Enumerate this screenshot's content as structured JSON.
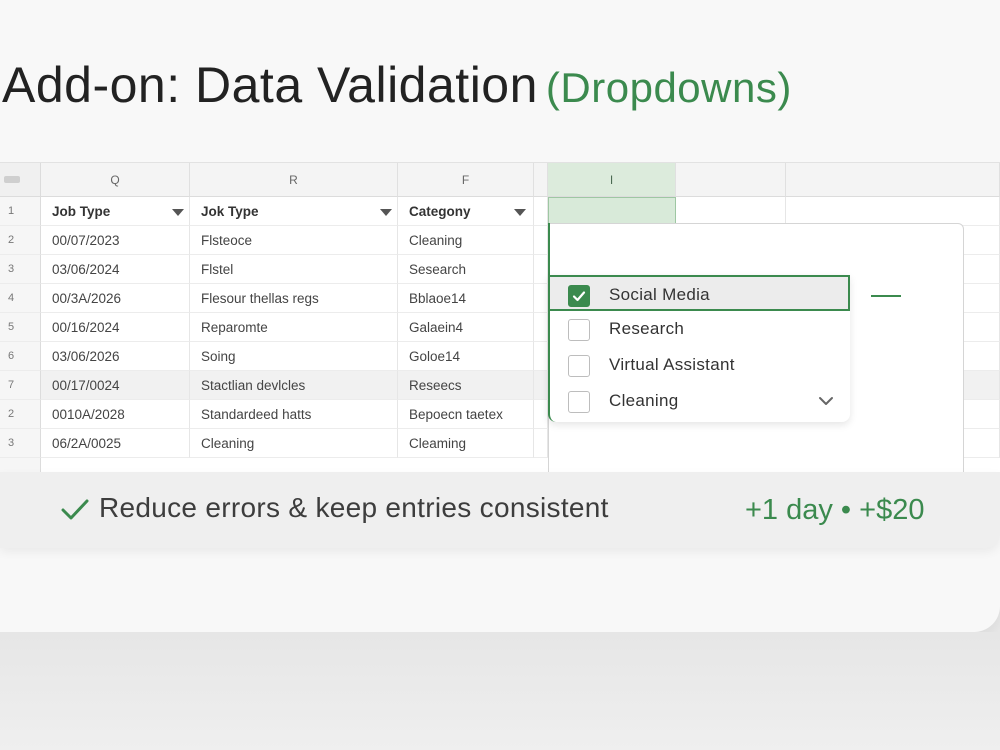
{
  "title": {
    "main": "Add-on: Data Validation",
    "accent": "(Dropdowns)"
  },
  "sheet": {
    "col_headers": [
      "Q",
      "R",
      "F",
      "I"
    ],
    "row_numbers": [
      "1",
      "2",
      "3",
      "4",
      "5",
      "6",
      "7",
      "2",
      "3"
    ],
    "header": [
      "Job Type",
      "Jok Type",
      "Categony"
    ],
    "rows": [
      [
        "00/07/2023",
        "Flsteoce",
        "Cleaning"
      ],
      [
        "03/06/2024",
        "Flstel",
        "Sesearch"
      ],
      [
        "00/3A/2026",
        "Flesour thellas regs",
        "Bblaoe14"
      ],
      [
        "00/16/2024",
        "Reparomte",
        "Galaein4"
      ],
      [
        "03/06/2026",
        "Soing",
        "Goloe14"
      ],
      [
        "00/17/0024",
        "Stactlian devlcles",
        "Reseecs"
      ],
      [
        "0010A/2028",
        "Standardeed hatts",
        "Bepoecn taetex"
      ],
      [
        "06/2A/0025",
        "Cleaning",
        "Cleaming"
      ]
    ]
  },
  "dropdown": {
    "options": [
      {
        "label": "Social Media",
        "checked": true
      },
      {
        "label": "Research",
        "checked": false
      },
      {
        "label": "Virtual Assistant",
        "checked": false
      },
      {
        "label": "Cleaning",
        "checked": false
      }
    ],
    "icons": {
      "check": "check-icon",
      "chevron": "chevron-down-icon"
    }
  },
  "benefit": {
    "text": "Reduce errors & keep entries consistent",
    "price": "+1 day • +$20"
  },
  "colors": {
    "accent": "#3b8a4e",
    "selected_cell": "#d8ead9"
  }
}
